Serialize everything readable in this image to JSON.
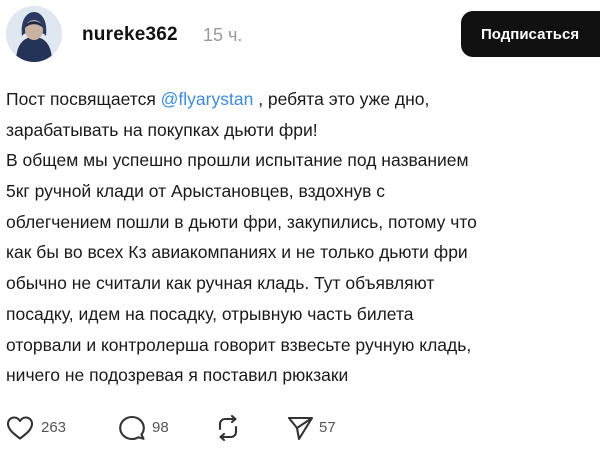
{
  "post": {
    "username": "nureke362",
    "time": "15 ч.",
    "follow_label": "Подписаться",
    "text": {
      "line1_before": "Пост посвящается ",
      "mention": "@flyarystan",
      "line1_after": " , ребята это уже дно,",
      "lines": [
        "зарабатывать на покупках дьюти фри!",
        "В общем мы успешно прошли испытание под названием",
        "5кг ручной клади от Арыстановцев, вздохнув с",
        "облегчением пошли в дьюти фри, закупились, потому что",
        "как бы во всех Кз авиакомпаниях и не только дьюти фри",
        "обычно не считали как ручная кладь. Тут объявляют",
        "посадку, идем на посадку, отрывную часть билета",
        "оторвали и контролерша говорит взвесьте ручную кладь,",
        "ничего не подозревая я поставил рюкзаки"
      ]
    },
    "actions": {
      "likes": "263",
      "comments": "98",
      "shares": "57"
    }
  },
  "colors": {
    "mention": "#3d8bd9",
    "button_bg": "#111111",
    "muted": "#9a9a9a"
  },
  "icons": [
    "heart-icon",
    "comment-icon",
    "repost-icon",
    "send-icon"
  ]
}
